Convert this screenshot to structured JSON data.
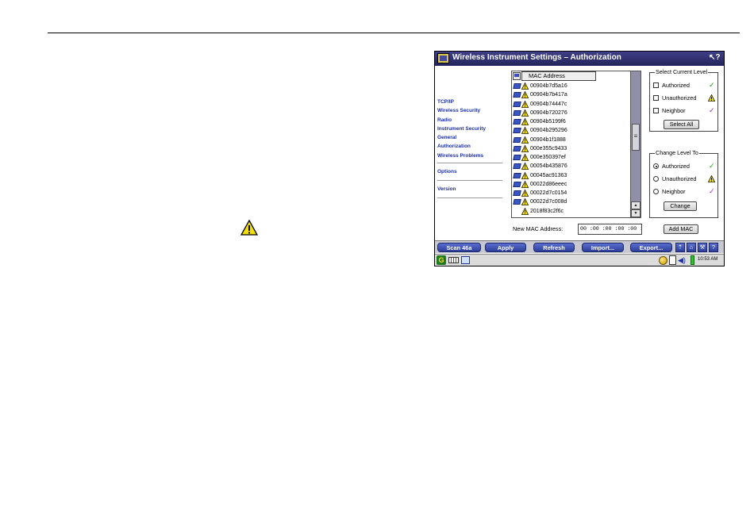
{
  "window": {
    "title": "Wireless Instrument Settings – Authorization",
    "help_icon": "whats-this-icon"
  },
  "sidebar": {
    "group1": [
      "TCP/IP",
      "Wireless Security",
      "Radio",
      "Instrument Security",
      "General",
      "Authorization",
      "Wireless Problems"
    ],
    "options": "Options",
    "version": "Version"
  },
  "mac_list": {
    "header": "MAC Address",
    "rows": [
      {
        "mac": "00904b7d5a16",
        "status": "unauthorized",
        "icon": "monitor-icon"
      },
      {
        "mac": "00904b7b417a",
        "status": "unauthorized",
        "icon": "monitor-icon"
      },
      {
        "mac": "00904b74447c",
        "status": "unauthorized",
        "icon": "monitor-icon"
      },
      {
        "mac": "00904b720276",
        "status": "unauthorized",
        "icon": "monitor-icon"
      },
      {
        "mac": "00904b5199f6",
        "status": "unauthorized",
        "icon": "monitor-icon"
      },
      {
        "mac": "00904b295296",
        "status": "unauthorized",
        "icon": "monitor-icon"
      },
      {
        "mac": "00904b1f1888",
        "status": "unauthorized",
        "icon": "monitor-icon"
      },
      {
        "mac": "000e355c9433",
        "status": "unauthorized",
        "icon": "monitor-icon"
      },
      {
        "mac": "000e350397ef",
        "status": "unauthorized",
        "icon": "monitor-icon"
      },
      {
        "mac": "00054b435876",
        "status": "unauthorized",
        "icon": "monitor-icon"
      },
      {
        "mac": "00045ac91363",
        "status": "unauthorized",
        "icon": "monitor-icon"
      },
      {
        "mac": "00022d86eeec",
        "status": "unauthorized",
        "icon": "monitor-icon"
      },
      {
        "mac": "00022d7c0154",
        "status": "unauthorized",
        "icon": "monitor-icon"
      },
      {
        "mac": "00022d7c008d",
        "status": "unauthorized",
        "icon": "monitor-icon"
      },
      {
        "mac": "2018f83c2f6c",
        "status": "unauthorized",
        "icon": ""
      }
    ]
  },
  "select_level": {
    "legend": "Select Current Level",
    "options": [
      {
        "label": "Authorized",
        "mark": "✓",
        "mark_icon": "green-check-icon",
        "checked": false
      },
      {
        "label": "Unauthorized",
        "mark": "",
        "mark_icon": "warning-icon",
        "checked": false
      },
      {
        "label": "Neighbor",
        "mark": "✓",
        "mark_icon": "purple-check-icon",
        "checked": false
      }
    ],
    "select_all_label": "Select All"
  },
  "change_level": {
    "legend": "Change Level To",
    "options": [
      {
        "label": "Authorized",
        "mark": "✓",
        "mark_icon": "green-check-icon",
        "selected": true
      },
      {
        "label": "Unauthorized",
        "mark": "",
        "mark_icon": "warning-icon",
        "selected": false
      },
      {
        "label": "Neighbor",
        "mark": "✓",
        "mark_icon": "purple-check-icon",
        "selected": false
      }
    ],
    "change_label": "Change"
  },
  "new_mac": {
    "label": "New MAC Address:",
    "value": "00 :00 :00 :00 :00 :00",
    "add_label": "Add MAC"
  },
  "softkeys": {
    "scan": "Scan 46a",
    "apply": "Apply",
    "refresh": "Refresh",
    "import": "Import...",
    "export": "Export..."
  },
  "status": {
    "time": "10:53 AM"
  },
  "colors": {
    "title_bar": "#2d2d6e",
    "link": "#1b2ea8",
    "softkey": "#3a4fb4",
    "check_green": "#18a018",
    "check_purple": "#a030c0",
    "warning_yellow": "#f3e000"
  }
}
